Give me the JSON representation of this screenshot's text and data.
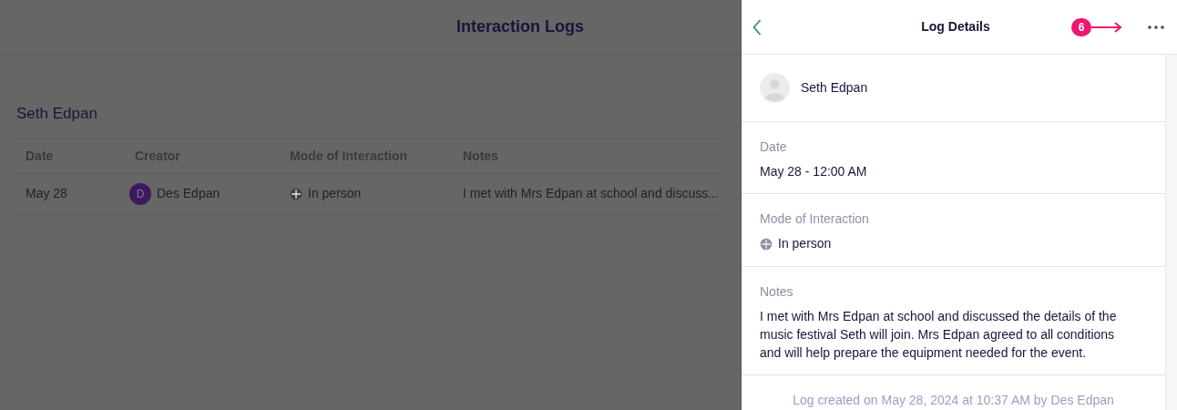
{
  "page": {
    "title": "Interaction Logs",
    "student": "Seth Edpan"
  },
  "table": {
    "columns": [
      "Date",
      "Creator",
      "Mode of Interaction",
      "Notes"
    ],
    "rows": [
      {
        "date": "May 28",
        "creator_initial": "D",
        "creator": "Des Edpan",
        "mode": "In person",
        "notes": "I met with Mrs Edpan at school and discuss..."
      }
    ]
  },
  "panel": {
    "title": "Log Details",
    "person": "Seth Edpan",
    "fields": [
      {
        "kind": "text",
        "label": "Date",
        "value": "May 28 - 12:00 AM"
      },
      {
        "kind": "mode",
        "label": "Mode of Interaction",
        "value": "In person"
      },
      {
        "kind": "text",
        "label": "Notes",
        "value": "I met with Mrs Edpan at school and discussed the details of the music festival Seth will join. Mrs Edpan agreed to all conditions and will help prepare the equipment needed for the event."
      }
    ],
    "footer": "Log created on May 28, 2024 at 10:37 AM by Des Edpan"
  },
  "annotation": {
    "number": "6"
  }
}
